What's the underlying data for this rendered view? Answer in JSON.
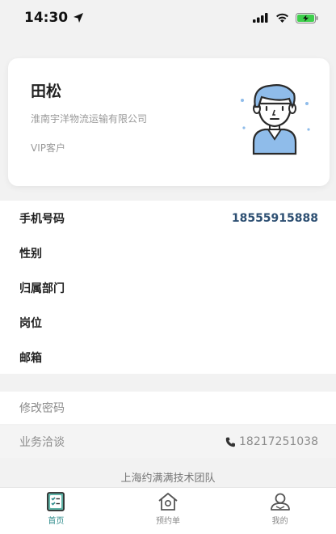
{
  "status_bar": {
    "time": "14:30",
    "icons": [
      "location-arrow-icon",
      "cellular-signal-icon",
      "wifi-icon",
      "battery-charging-icon"
    ]
  },
  "profile": {
    "name": "田松",
    "company": "淮南宇洋物流运输有限公司",
    "customer_type": "VIP客户",
    "avatar_icon": "user-avatar-illustration"
  },
  "info_rows": [
    {
      "label": "手机号码",
      "value": "18555915888"
    },
    {
      "label": "性别",
      "value": ""
    },
    {
      "label": "归属部门",
      "value": ""
    },
    {
      "label": "岗位",
      "value": ""
    },
    {
      "label": "邮箱",
      "value": ""
    }
  ],
  "actions": {
    "change_password": "修改密码",
    "business_label": "业务洽谈",
    "business_phone": "18217251038"
  },
  "footer": "上海约满满技术团队",
  "tab_bar": {
    "tabs": [
      {
        "label": "首页",
        "icon": "home-list-icon",
        "active": true
      },
      {
        "label": "预约单",
        "icon": "house-icon",
        "active": false
      },
      {
        "label": "我的",
        "icon": "profile-icon",
        "active": false
      }
    ]
  },
  "colors": {
    "accent": "#2e8b8b",
    "phone_value": "#2d4f72",
    "muted_text": "#9a9a9a",
    "avatar_blue": "#8fbcea"
  }
}
